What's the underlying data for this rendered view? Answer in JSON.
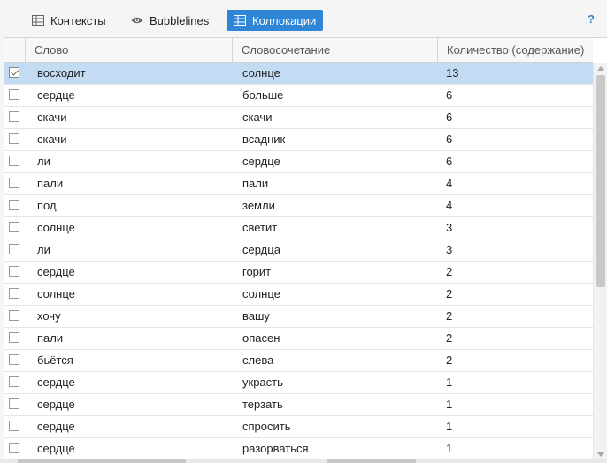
{
  "tabs": [
    {
      "label": "Контексты",
      "icon": "table-icon",
      "active": false
    },
    {
      "label": "Bubblelines",
      "icon": "eye-icon",
      "active": false
    },
    {
      "label": "Коллокации",
      "icon": "table-icon",
      "active": true
    }
  ],
  "help": {
    "label": "?"
  },
  "table": {
    "columns": [
      "Слово",
      "Словосочетание",
      "Количество (содержание)"
    ],
    "rows": [
      {
        "word": "восходит",
        "collocate": "солнце",
        "count": "13",
        "checked": true,
        "selected": true
      },
      {
        "word": "сердце",
        "collocate": "больше",
        "count": "6",
        "checked": false,
        "selected": false
      },
      {
        "word": "скачи",
        "collocate": "скачи",
        "count": "6",
        "checked": false,
        "selected": false
      },
      {
        "word": "скачи",
        "collocate": "всадник",
        "count": "6",
        "checked": false,
        "selected": false
      },
      {
        "word": "ли",
        "collocate": "сердце",
        "count": "6",
        "checked": false,
        "selected": false
      },
      {
        "word": "пали",
        "collocate": "пали",
        "count": "4",
        "checked": false,
        "selected": false
      },
      {
        "word": "под",
        "collocate": "земли",
        "count": "4",
        "checked": false,
        "selected": false
      },
      {
        "word": "солнце",
        "collocate": "светит",
        "count": "3",
        "checked": false,
        "selected": false
      },
      {
        "word": "ли",
        "collocate": "сердца",
        "count": "3",
        "checked": false,
        "selected": false
      },
      {
        "word": "сердце",
        "collocate": "горит",
        "count": "2",
        "checked": false,
        "selected": false
      },
      {
        "word": "солнце",
        "collocate": "солнце",
        "count": "2",
        "checked": false,
        "selected": false
      },
      {
        "word": "хочу",
        "collocate": "вашу",
        "count": "2",
        "checked": false,
        "selected": false
      },
      {
        "word": "пали",
        "collocate": "опасен",
        "count": "2",
        "checked": false,
        "selected": false
      },
      {
        "word": "бьётся",
        "collocate": "слева",
        "count": "2",
        "checked": false,
        "selected": false
      },
      {
        "word": "сердце",
        "collocate": "украсть",
        "count": "1",
        "checked": false,
        "selected": false
      },
      {
        "word": "сердце",
        "collocate": "терзать",
        "count": "1",
        "checked": false,
        "selected": false
      },
      {
        "word": "сердце",
        "collocate": "спросить",
        "count": "1",
        "checked": false,
        "selected": false
      },
      {
        "word": "сердце",
        "collocate": "разорваться",
        "count": "1",
        "checked": false,
        "selected": false
      }
    ]
  },
  "colors": {
    "accent": "#2f86d6",
    "selected_row": "#c4dcf3"
  }
}
